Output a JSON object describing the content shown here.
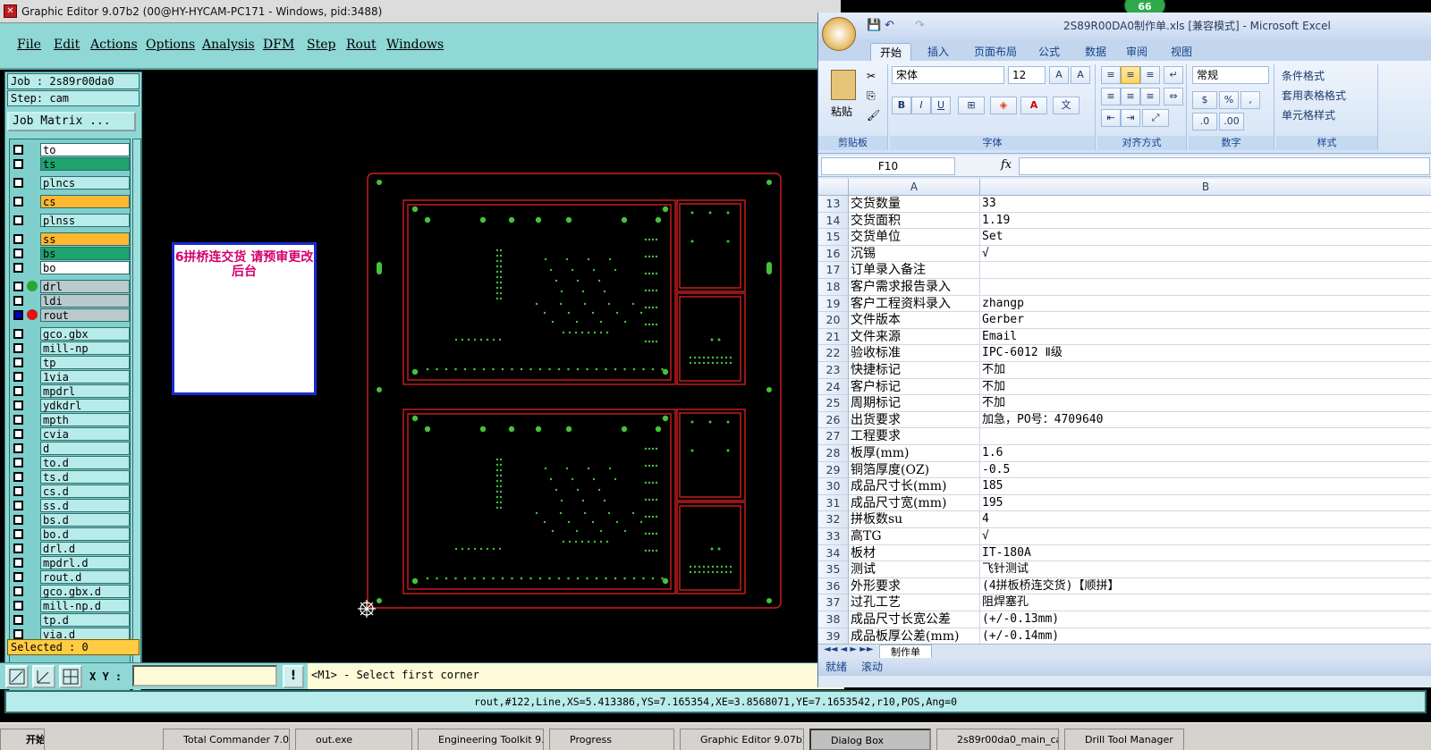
{
  "genesis": {
    "title": "Graphic Editor 9.07b2 (00@HY-HYCAM-PC171 - Windows, pid:3488)",
    "menu": [
      "File",
      "Edit",
      "Actions",
      "Options",
      "Analysis",
      "DFM",
      "Step",
      "Rout",
      "Windows"
    ],
    "job": "Job : 2s89r00da0",
    "step": "Step: cam",
    "job_matrix": "Job Matrix ...",
    "layers": [
      {
        "name": "to",
        "color": "#ffffff",
        "dot": ""
      },
      {
        "name": "ts",
        "color": "#1fa36f",
        "dot": ""
      },
      {
        "name": "plncs",
        "color": "#b8ecea",
        "dot": ""
      },
      {
        "name": "cs",
        "color": "#ffb830",
        "dot": ""
      },
      {
        "name": "plnss",
        "color": "#b8ecea",
        "dot": ""
      },
      {
        "name": "ss",
        "color": "#ffb830",
        "dot": ""
      },
      {
        "name": "bs",
        "color": "#1fa36f",
        "dot": ""
      },
      {
        "name": "bo",
        "color": "#ffffff",
        "dot": ""
      },
      {
        "name": "drl",
        "color": "#b9c9cc",
        "dot": "#2ea52e"
      },
      {
        "name": "ldi",
        "color": "#b9c9cc",
        "dot": ""
      },
      {
        "name": "rout",
        "color": "#b9c9cc",
        "dot": "#e01515",
        "selected": true
      },
      {
        "name": "gco.gbx",
        "color": "#b8ecea",
        "dot": ""
      },
      {
        "name": "mill-np",
        "color": "#b8ecea",
        "dot": ""
      },
      {
        "name": "tp",
        "color": "#b8ecea",
        "dot": ""
      },
      {
        "name": "1via",
        "color": "#b8ecea",
        "dot": ""
      },
      {
        "name": "mpdrl",
        "color": "#b8ecea",
        "dot": ""
      },
      {
        "name": "ydkdrl",
        "color": "#b8ecea",
        "dot": ""
      },
      {
        "name": "mpth",
        "color": "#b8ecea",
        "dot": ""
      },
      {
        "name": "cvia",
        "color": "#b8ecea",
        "dot": ""
      },
      {
        "name": "d",
        "color": "#b8ecea",
        "dot": ""
      },
      {
        "name": "to.d",
        "color": "#b8ecea",
        "dot": ""
      },
      {
        "name": "ts.d",
        "color": "#b8ecea",
        "dot": ""
      },
      {
        "name": "cs.d",
        "color": "#b8ecea",
        "dot": ""
      },
      {
        "name": "ss.d",
        "color": "#b8ecea",
        "dot": ""
      },
      {
        "name": "bs.d",
        "color": "#b8ecea",
        "dot": ""
      },
      {
        "name": "bo.d",
        "color": "#b8ecea",
        "dot": ""
      },
      {
        "name": "drl.d",
        "color": "#b8ecea",
        "dot": ""
      },
      {
        "name": "mpdrl.d",
        "color": "#b8ecea",
        "dot": ""
      },
      {
        "name": "rout.d",
        "color": "#b8ecea",
        "dot": ""
      },
      {
        "name": "gco.gbx.d",
        "color": "#b8ecea",
        "dot": ""
      },
      {
        "name": "mill-np.d",
        "color": "#b8ecea",
        "dot": ""
      },
      {
        "name": "tp.d",
        "color": "#b8ecea",
        "dot": ""
      },
      {
        "name": "via.d",
        "color": "#b8ecea",
        "dot": ""
      }
    ],
    "selected": "Selected : 0",
    "note": "6拼桥连交货 请预审更改后台",
    "xy_label": "X Y :",
    "xy_value": "",
    "message": "<M1> - Select first corner",
    "status": "rout,#122,Line,XS=5.413386,YS=7.165354,XE=3.8568071,YE=7.1653542,r10,POS,Ang=0"
  },
  "excel": {
    "title": "2S89R00DA0制作单.xls [兼容模式] - Microsoft Excel",
    "badge": "66",
    "tabs": [
      "开始",
      "插入",
      "页面布局",
      "公式",
      "数据",
      "审阅",
      "视图"
    ],
    "font_name": "宋体",
    "font_size": "12",
    "number_format": "常规",
    "groups": [
      "剪贴板",
      "字体",
      "对齐方式",
      "数字",
      "样式"
    ],
    "paste_label": "粘贴",
    "style_buttons": [
      "条件格式",
      "套用表格格式",
      "单元格样式"
    ],
    "cell_ref": "F10",
    "fx": "fx",
    "col_a": "A",
    "col_b": "B",
    "rows": [
      {
        "n": "13",
        "a": "交货数量",
        "b": "33"
      },
      {
        "n": "14",
        "a": "交货面积",
        "b": "1.19"
      },
      {
        "n": "15",
        "a": "交货单位",
        "b": "Set"
      },
      {
        "n": "16",
        "a": "沉锡",
        "b": "√"
      },
      {
        "n": "17",
        "a": "订单录入备注",
        "b": ""
      },
      {
        "n": "18",
        "a": "客户需求报告录入",
        "b": ""
      },
      {
        "n": "19",
        "a": "客户工程资料录入",
        "b": "zhangp"
      },
      {
        "n": "20",
        "a": "文件版本",
        "b": "Gerber"
      },
      {
        "n": "21",
        "a": "文件来源",
        "b": "Email"
      },
      {
        "n": "22",
        "a": "验收标准",
        "b": "IPC-6012 Ⅱ级"
      },
      {
        "n": "23",
        "a": "快捷标记",
        "b": "不加"
      },
      {
        "n": "24",
        "a": "客户标记",
        "b": "不加"
      },
      {
        "n": "25",
        "a": "周期标记",
        "b": "不加"
      },
      {
        "n": "26",
        "a": "出货要求",
        "b": "加急，PO号：4709640"
      },
      {
        "n": "27",
        "a": "工程要求",
        "b": ""
      },
      {
        "n": "28",
        "a": "板厚(mm)",
        "b": "1.6"
      },
      {
        "n": "29",
        "a": "铜箔厚度(OZ)",
        "b": "-0.5"
      },
      {
        "n": "30",
        "a": "成品尺寸长(mm)",
        "b": "185"
      },
      {
        "n": "31",
        "a": "成品尺寸宽(mm)",
        "b": "195"
      },
      {
        "n": "32",
        "a": "拼板数su",
        "b": "4"
      },
      {
        "n": "33",
        "a": "高TG",
        "b": "√"
      },
      {
        "n": "34",
        "a": "板材",
        "b": "IT-180A"
      },
      {
        "n": "35",
        "a": "测试",
        "b": "飞针测试"
      },
      {
        "n": "36",
        "a": "外形要求",
        "b": "(4拼板桥连交货)【顺拼】"
      },
      {
        "n": "37",
        "a": "过孔工艺",
        "b": "阻焊塞孔"
      },
      {
        "n": "38",
        "a": "成品尺寸长宽公差",
        "b": "(+/-0.13mm)"
      },
      {
        "n": "39",
        "a": "成品板厚公差(mm)",
        "b": "(+/-0.14mm)"
      }
    ],
    "sheet_tab": "制作单",
    "status_ready": "就绪",
    "status_scroll": "滚动"
  },
  "taskbar": {
    "start": "开始",
    "tasks": [
      "Total Commander 7.0...",
      "out.exe",
      "Engineering Toolkit 9...",
      "Progress",
      "Graphic Editor 9.07b2...",
      "Dialog Box",
      "2s89r00da0_main_ca...",
      "Drill Tool Manager"
    ]
  }
}
